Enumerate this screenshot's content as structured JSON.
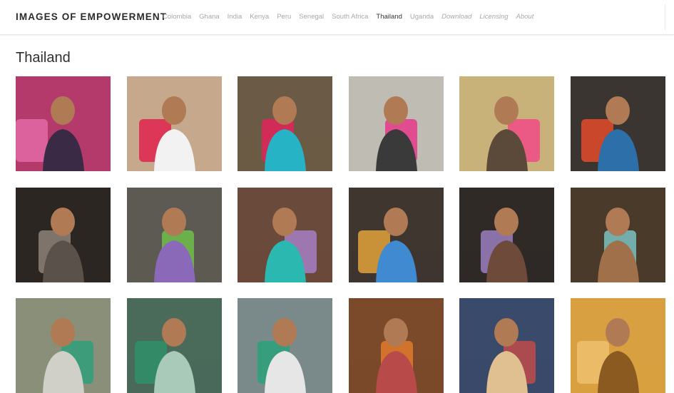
{
  "site": {
    "title": "IMAGES OF EMPOWERMENT"
  },
  "nav": {
    "items": [
      {
        "label": "Colombia",
        "active": false,
        "util": false
      },
      {
        "label": "Ghana",
        "active": false,
        "util": false
      },
      {
        "label": "India",
        "active": false,
        "util": false
      },
      {
        "label": "Kenya",
        "active": false,
        "util": false
      },
      {
        "label": "Peru",
        "active": false,
        "util": false
      },
      {
        "label": "Senegal",
        "active": false,
        "util": false
      },
      {
        "label": "South Africa",
        "active": false,
        "util": false
      },
      {
        "label": "Thailand",
        "active": true,
        "util": false
      },
      {
        "label": "Uganda",
        "active": false,
        "util": false
      },
      {
        "label": "Download",
        "active": false,
        "util": true
      },
      {
        "label": "Licensing",
        "active": false,
        "util": true
      },
      {
        "label": "About",
        "active": false,
        "util": true
      }
    ]
  },
  "page": {
    "heading": "Thailand"
  },
  "gallery": {
    "photos": [
      {
        "bg": "#b33a6b",
        "accent": "#e36aa6",
        "figure": "#3a2a45"
      },
      {
        "bg": "#c6a88c",
        "accent": "#e0234e",
        "figure": "#f2f2f2"
      },
      {
        "bg": "#6b5a45",
        "accent": "#e3235a",
        "figure": "#27b3c6"
      },
      {
        "bg": "#bfbcb4",
        "accent": "#e6388a",
        "figure": "#3a3a3a"
      },
      {
        "bg": "#c9b27a",
        "accent": "#f14a86",
        "figure": "#5b4a3a"
      },
      {
        "bg": "#3a3530",
        "accent": "#e44a2a",
        "figure": "#2d6fa8"
      },
      {
        "bg": "#2b2622",
        "accent": "#8d8378",
        "figure": "#5a524a"
      },
      {
        "bg": "#5c5a52",
        "accent": "#6fc04a",
        "figure": "#8a6ab8"
      },
      {
        "bg": "#6a4a3a",
        "accent": "#a77fc6",
        "figure": "#2bb8b0"
      },
      {
        "bg": "#3f3630",
        "accent": "#e2a13a",
        "figure": "#3f8ad0"
      },
      {
        "bg": "#2f2a26",
        "accent": "#9a7fc0",
        "figure": "#6e4a3a"
      },
      {
        "bg": "#4a3a2a",
        "accent": "#7bc3c3",
        "figure": "#a0704a"
      },
      {
        "bg": "#8a8f7a",
        "accent": "#2f9f7a",
        "figure": "#d0d0c8"
      },
      {
        "bg": "#4a6a5a",
        "accent": "#2e8f6a",
        "figure": "#a9c9b9"
      },
      {
        "bg": "#7a8a8a",
        "accent": "#2aa07a",
        "figure": "#e6e6e6"
      },
      {
        "bg": "#7a4a2a",
        "accent": "#e07a2a",
        "figure": "#b84a4a"
      },
      {
        "bg": "#3a4a6a",
        "accent": "#c04a4a",
        "figure": "#e0c090"
      },
      {
        "bg": "#d8a040",
        "accent": "#f0c070",
        "figure": "#8a5a20"
      }
    ]
  }
}
